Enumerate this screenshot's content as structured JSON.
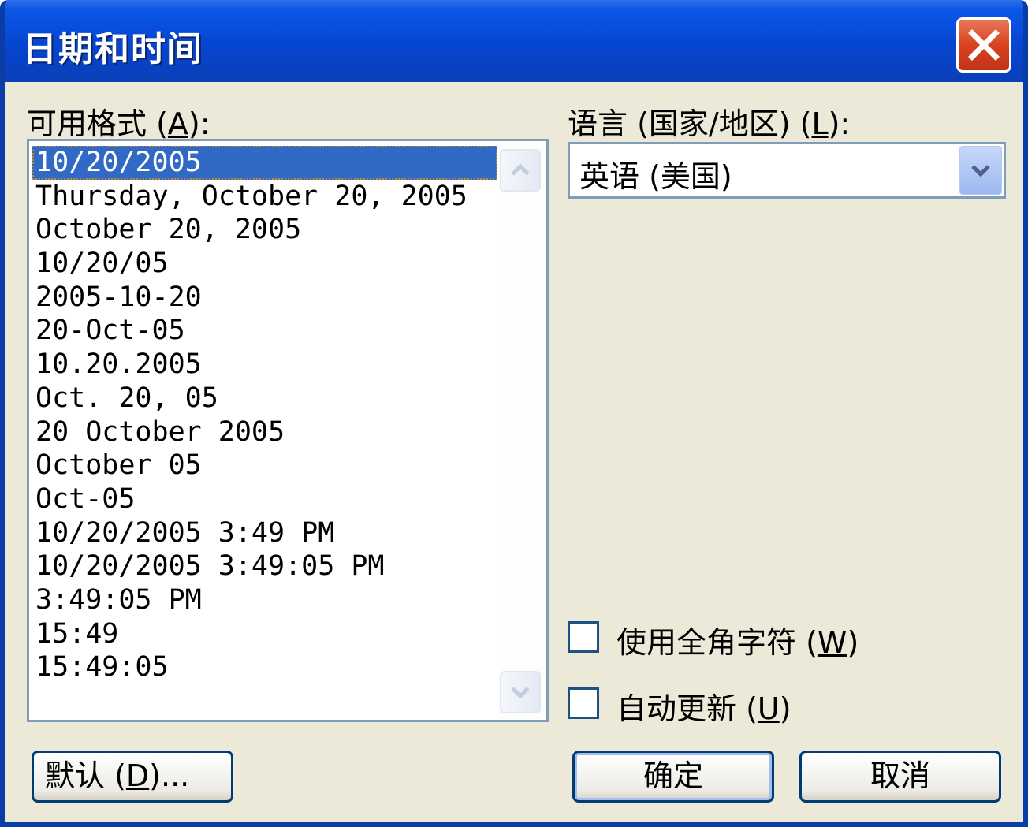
{
  "window": {
    "title": "日期和时间"
  },
  "formats": {
    "label_pre": "可用格式 (",
    "label_key": "A",
    "label_post": "):",
    "items": [
      "10/20/2005",
      "Thursday, October 20, 2005",
      "October 20, 2005",
      "10/20/05",
      "2005-10-20",
      "20-Oct-05",
      "10.20.2005",
      "Oct. 20, 05",
      "20 October 2005",
      "October 05",
      "Oct-05",
      "10/20/2005 3:49 PM",
      "10/20/2005 3:49:05 PM",
      "3:49:05 PM",
      "15:49",
      "15:49:05"
    ],
    "selected_index": 0
  },
  "language": {
    "label_pre": "语言 (国家/地区) (",
    "label_key": "L",
    "label_post": "):",
    "value": "英语 (美国)"
  },
  "options": {
    "fullwidth": {
      "label_pre": "使用全角字符 (",
      "label_key": "W",
      "label_post": ")",
      "checked": false
    },
    "autoupdate": {
      "label_pre": "自动更新 (",
      "label_key": "U",
      "label_post": ")",
      "checked": false
    }
  },
  "buttons": {
    "default_pre": "默认 (",
    "default_key": "D",
    "default_post": ")...",
    "ok": "确定",
    "cancel": "取消"
  },
  "icons": {
    "close": "close-x-icon",
    "scroll_up": "chevron-up-icon",
    "scroll_down": "chevron-down-icon",
    "dropdown": "chevron-down-icon"
  }
}
